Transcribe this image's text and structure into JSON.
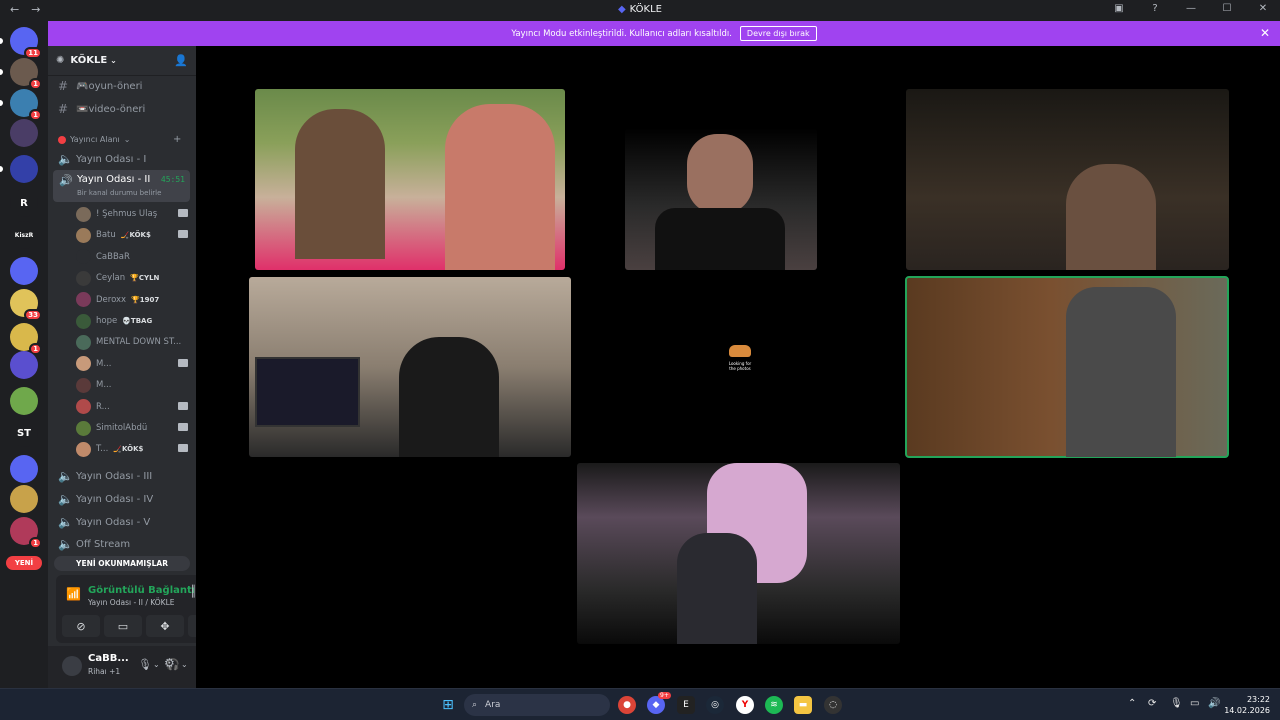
{
  "titlebar": {
    "title": "KÖKLE",
    "back": "←",
    "forward": "→"
  },
  "banner": {
    "message": "Yayıncı Modu etkinleştirildi. Kullanıcı adları kısaltıldı.",
    "button": "Devre dışı bırak",
    "close": "✕"
  },
  "guilds": {
    "items": [
      {
        "label": "",
        "badge": "11",
        "color": "#5865f2"
      },
      {
        "label": "",
        "badge": "1",
        "color": "#6b5a4e"
      },
      {
        "label": "",
        "badge": "1",
        "color": "#3b7fb0"
      },
      {
        "label": "",
        "badge": "",
        "color": "#4a3d66"
      },
      {
        "label": "",
        "badge": "",
        "color": "#3340a8"
      },
      {
        "label": "R",
        "badge": "",
        "color": "#1e1f22"
      },
      {
        "label": "KiszR",
        "badge": "",
        "color": "#1e1f22"
      },
      {
        "label": "",
        "badge": "",
        "color": "#5865f2"
      },
      {
        "label": "",
        "badge": "33",
        "color": "#e0c35a"
      },
      {
        "label": "",
        "badge": "1",
        "color": "#d9b84b"
      },
      {
        "label": "",
        "badge": "",
        "color": "#5a4fcf"
      },
      {
        "label": "",
        "badge": "",
        "color": "#6fa84b"
      },
      {
        "label": "ST",
        "badge": "",
        "color": "#1e1f22"
      },
      {
        "label": "",
        "badge": "",
        "color": "#5865f2"
      },
      {
        "label": "",
        "badge": "",
        "color": "#c8a24a"
      },
      {
        "label": "",
        "badge": "1",
        "color": "#b03a5a"
      }
    ],
    "new_label": "YENİ"
  },
  "server": {
    "name": "KÖKLE"
  },
  "channels": {
    "text": [
      {
        "name": "🎮oyun-öneri"
      },
      {
        "name": "📼video-öneri"
      }
    ],
    "category": "Yayıncı Alanı",
    "voice": [
      {
        "name": "Yayın Odası - I"
      },
      {
        "name": "Yayın Odası - II",
        "time": "45:51",
        "status": "Bir kanal durumu belirle"
      },
      {
        "name": "Yayın Odası - III"
      },
      {
        "name": "Yayın Odası - IV"
      },
      {
        "name": "Yayın Odası - V"
      },
      {
        "name": "Off Stream"
      }
    ],
    "members": [
      {
        "name": "! Şehmus Ulaş",
        "tag": "",
        "cam": true,
        "color": "#7a6a5a"
      },
      {
        "name": "Batu",
        "tag": "🏒KÖK$",
        "cam": true,
        "color": "#9a7a5a"
      },
      {
        "name": "CaBBaR",
        "tag": "",
        "cam": false,
        "color": "#2b2d31"
      },
      {
        "name": "Ceylan",
        "tag": "🏆CYLN",
        "cam": false,
        "color": "#3a3a3a"
      },
      {
        "name": "Deroxx",
        "tag": "🏆1907",
        "cam": false,
        "color": "#7a3a5a"
      },
      {
        "name": "hope",
        "tag": "💀TBAG",
        "cam": false,
        "color": "#3a5a3a"
      },
      {
        "name": "MENTAL DOWN ST...",
        "tag": "",
        "cam": false,
        "color": "#4a6a5a"
      },
      {
        "name": "M...",
        "tag": "",
        "cam": true,
        "color": "#c89a7a"
      },
      {
        "name": "M...",
        "tag": "",
        "cam": false,
        "color": "#5a3a3a"
      },
      {
        "name": "R...",
        "tag": "",
        "cam": true,
        "color": "#b04a4a"
      },
      {
        "name": "SimitolAbdü",
        "tag": "",
        "cam": true,
        "color": "#5a7a3a"
      },
      {
        "name": "T...",
        "tag": "🏒KÖK$",
        "cam": true,
        "color": "#c08a6a"
      }
    ],
    "unread_button": "YENİ OKUNMAMIŞLAR"
  },
  "voice_panel": {
    "title": "Görüntülü Bağlantı",
    "subtitle": "Yayın Odası - II / KÖKLE"
  },
  "user_panel": {
    "name": "CaBB...",
    "status": "Rihaı +1"
  },
  "stage": {
    "loading_text": "Looking for the photos"
  },
  "taskbar": {
    "search_placeholder": "Ara",
    "time": "23:22",
    "date": "14.02.2026",
    "discord_badge": "9+"
  }
}
